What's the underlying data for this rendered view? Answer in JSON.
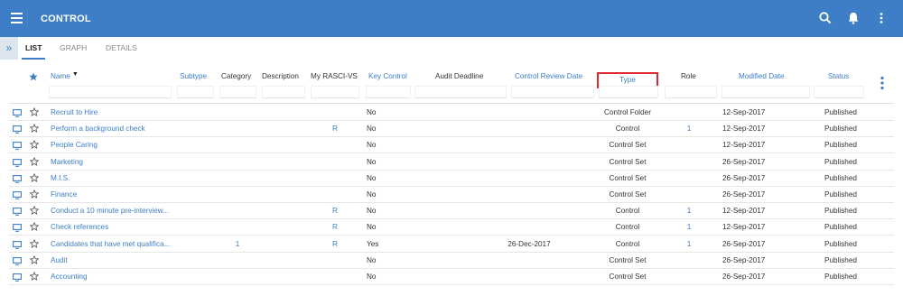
{
  "header": {
    "title": "CONTROL",
    "icons": [
      "menu-icon",
      "search-icon",
      "bell-icon",
      "more-vertical-icon"
    ],
    "accent_color": "#3d7ec6"
  },
  "tabs": [
    {
      "label": "LIST",
      "active": true
    },
    {
      "label": "GRAPH",
      "active": false
    },
    {
      "label": "DETAILS",
      "active": false
    }
  ],
  "columns": {
    "name": "Name",
    "subtype": "Subtype",
    "category": "Category",
    "description": "Description",
    "rasci": "My RASCI-VS",
    "key_control": "Key Control",
    "audit_deadline": "Audit Deadline",
    "review_date": "Control Review Date",
    "type": "Type",
    "role": "Role",
    "modified": "Modified Date",
    "status": "Status"
  },
  "highlight_color": "#e0282e",
  "rows": [
    {
      "name": "Recruit to Hire",
      "subtype": "",
      "category": "",
      "rasci": "",
      "key_control": "No",
      "audit_deadline": "",
      "type": "Control Folder",
      "role": "",
      "modified": "12-Sep-2017",
      "status": "Published"
    },
    {
      "name": "Perform a background check",
      "subtype": "",
      "category": "",
      "rasci": "R",
      "key_control": "No",
      "audit_deadline": "",
      "type": "Control",
      "role": "1",
      "modified": "12-Sep-2017",
      "status": "Published"
    },
    {
      "name": "People Caring",
      "subtype": "",
      "category": "",
      "rasci": "",
      "key_control": "No",
      "audit_deadline": "",
      "type": "Control Set",
      "role": "",
      "modified": "12-Sep-2017",
      "status": "Published"
    },
    {
      "name": "Marketing",
      "subtype": "",
      "category": "",
      "rasci": "",
      "key_control": "No",
      "audit_deadline": "",
      "type": "Control Set",
      "role": "",
      "modified": "26-Sep-2017",
      "status": "Published"
    },
    {
      "name": "M.I.S.",
      "subtype": "",
      "category": "",
      "rasci": "",
      "key_control": "No",
      "audit_deadline": "",
      "type": "Control Set",
      "role": "",
      "modified": "26-Sep-2017",
      "status": "Published"
    },
    {
      "name": "Finance",
      "subtype": "",
      "category": "",
      "rasci": "",
      "key_control": "No",
      "audit_deadline": "",
      "type": "Control Set",
      "role": "",
      "modified": "26-Sep-2017",
      "status": "Published"
    },
    {
      "name": "Conduct a 10 minute pre-interview...",
      "subtype": "",
      "category": "",
      "rasci": "R",
      "key_control": "No",
      "audit_deadline": "",
      "type": "Control",
      "role": "1",
      "modified": "12-Sep-2017",
      "status": "Published"
    },
    {
      "name": "Check references",
      "subtype": "",
      "category": "",
      "rasci": "R",
      "key_control": "No",
      "audit_deadline": "",
      "type": "Control",
      "role": "1",
      "modified": "12-Sep-2017",
      "status": "Published"
    },
    {
      "name": "Candidates that have met qualifica...",
      "subtype": "",
      "category": "1",
      "rasci": "R",
      "key_control": "Yes",
      "audit_deadline": "26-Dec-2017",
      "type": "Control",
      "role": "1",
      "modified": "26-Sep-2017",
      "status": "Published"
    },
    {
      "name": "Audit",
      "subtype": "",
      "category": "",
      "rasci": "",
      "key_control": "No",
      "audit_deadline": "",
      "type": "Control Set",
      "role": "",
      "modified": "26-Sep-2017",
      "status": "Published"
    },
    {
      "name": "Accounting",
      "subtype": "",
      "category": "",
      "rasci": "",
      "key_control": "No",
      "audit_deadline": "",
      "type": "Control Set",
      "role": "",
      "modified": "26-Sep-2017",
      "status": "Published"
    }
  ]
}
